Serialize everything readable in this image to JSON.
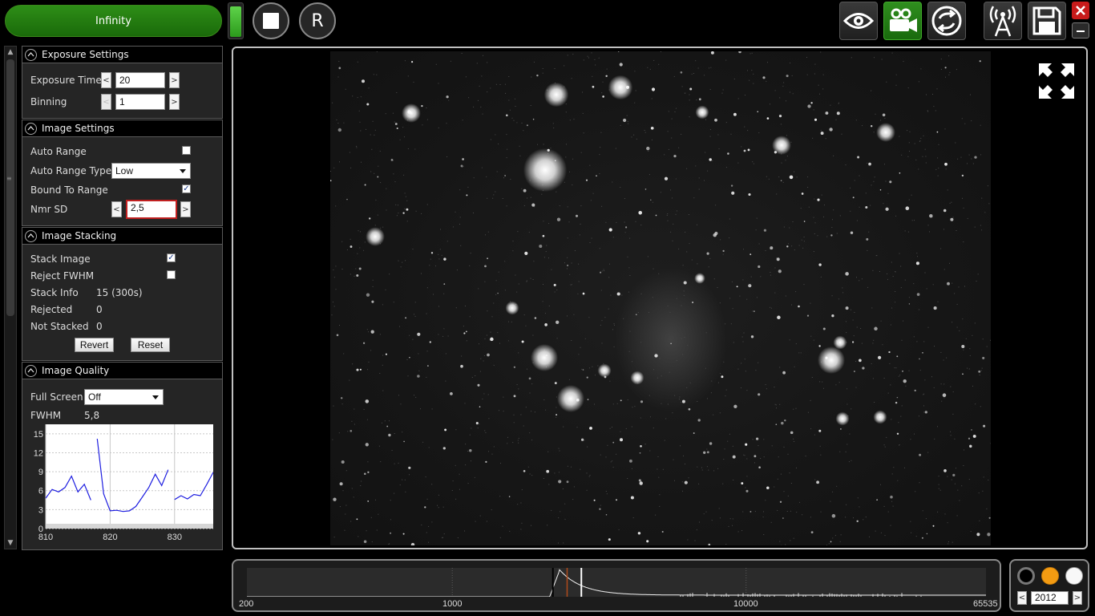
{
  "top_bar": {
    "infinity_label": "Infinity",
    "battery_level": 0.95,
    "r_label": "R"
  },
  "exposure_settings": {
    "title": "Exposure Settings",
    "exposure_time_label": "Exposure Time",
    "exposure_time_value": "20",
    "binning_label": "Binning",
    "binning_value": "1"
  },
  "image_settings": {
    "title": "Image Settings",
    "auto_range_label": "Auto Range",
    "auto_range_checked": false,
    "auto_range_type_label": "Auto Range Type",
    "auto_range_type_value": "Low",
    "bound_to_range_label": "Bound To Range",
    "bound_to_range_checked": true,
    "nmr_sd_label": "Nmr SD",
    "nmr_sd_value": "2,5"
  },
  "image_stacking": {
    "title": "Image Stacking",
    "stack_image_label": "Stack Image",
    "stack_image_checked": true,
    "reject_fwhm_label": "Reject FWHM",
    "reject_fwhm_checked": false,
    "stack_info_label": "Stack Info",
    "stack_info_value": "15 (300s)",
    "rejected_label": "Rejected",
    "rejected_value": "0",
    "not_stacked_label": "Not Stacked",
    "not_stacked_value": "0",
    "revert_label": "Revert",
    "reset_label": "Reset"
  },
  "image_quality": {
    "title": "Image Quality",
    "full_screen_label": "Full Screen",
    "full_screen_value": "Off",
    "fwhm_label": "FWHM",
    "fwhm_value": "5,8"
  },
  "chart_data": {
    "type": "line",
    "title": "",
    "xlabel": "",
    "ylabel": "",
    "xlim": [
      810,
      836
    ],
    "ylim": [
      0,
      16.5
    ],
    "x_ticks": [
      "810",
      "820",
      "830"
    ],
    "y_ticks": [
      "0",
      "3",
      "6",
      "9",
      "12",
      "15"
    ],
    "grid": true,
    "series": [
      {
        "color": "#1e1ee0",
        "segments": [
          [
            [
              810,
              4.8
            ],
            [
              811,
              6.2
            ],
            [
              812,
              5.8
            ],
            [
              813,
              6.5
            ],
            [
              814,
              8.3
            ],
            [
              815,
              5.8
            ],
            [
              816,
              7.0
            ],
            [
              817,
              4.5
            ]
          ],
          [
            [
              818,
              14.2
            ],
            [
              819,
              5.5
            ],
            [
              820,
              2.8
            ],
            [
              821,
              2.9
            ],
            [
              822,
              2.7
            ],
            [
              823,
              2.8
            ],
            [
              824,
              3.5
            ],
            [
              825,
              5.0
            ],
            [
              826,
              6.5
            ],
            [
              827,
              8.6
            ],
            [
              828,
              6.8
            ],
            [
              829,
              9.3
            ]
          ],
          [
            [
              830,
              4.6
            ],
            [
              831,
              5.2
            ],
            [
              832,
              4.7
            ],
            [
              833,
              5.4
            ],
            [
              834,
              5.2
            ],
            [
              835,
              7.0
            ],
            [
              836,
              8.9
            ]
          ],
          [
            [
              836.2,
              4.8
            ],
            [
              837,
              4.7
            ],
            [
              838,
              6.2
            ]
          ]
        ]
      }
    ]
  },
  "histogram": {
    "ticks": [
      "200",
      "1000",
      "10000",
      "65535"
    ],
    "min": 200,
    "max": 65535,
    "black_point": 2200,
    "white_point": 2750
  },
  "color_panel": {
    "year_value": "2012"
  },
  "colors": {
    "accent_green": "#2e8e17",
    "error_red": "#c02020",
    "orange": "#f39b12"
  },
  "icons": {
    "eye": "eye-icon",
    "camera": "video-camera-icon",
    "cycle": "refresh-cycle-icon",
    "antenna": "wireless-antenna-icon",
    "save": "floppy-disk-icon",
    "close": "close-icon",
    "minimize": "minimize-icon",
    "fullscreen": "fullscreen-icon"
  }
}
